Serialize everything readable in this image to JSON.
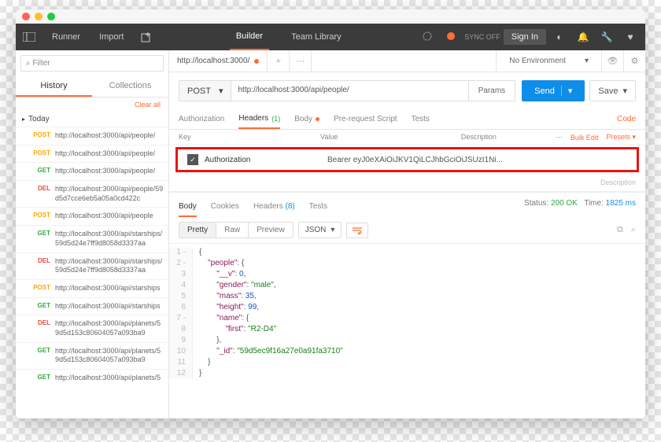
{
  "topbar": {
    "runner": "Runner",
    "import": "Import",
    "tabs": {
      "builder": "Builder",
      "teamlib": "Team Library"
    },
    "sync": "SYNC OFF",
    "signin": "Sign In"
  },
  "sidebar": {
    "filter_placeholder": "Filter",
    "tabs": {
      "history": "History",
      "collections": "Collections"
    },
    "clear": "Clear all",
    "group": "Today",
    "items": [
      {
        "m": "POST",
        "u": "http://localhost:3000/api/people/"
      },
      {
        "m": "POST",
        "u": "http://localhost:3000/api/people/"
      },
      {
        "m": "GET",
        "u": "http://localhost:3000/api/people/"
      },
      {
        "m": "DEL",
        "u": "http://localhost:3000/api/people/59d5d7cce6eb5a05a0cd422c"
      },
      {
        "m": "POST",
        "u": "http://localhost:3000/api/people"
      },
      {
        "m": "GET",
        "u": "http://localhost:3000/api/starships/59d5d24e7ff9d8058d3337aa"
      },
      {
        "m": "DEL",
        "u": "http://localhost:3000/api/starships/59d5d24e7ff9d8058d3337aa"
      },
      {
        "m": "POST",
        "u": "http://localhost:3000/api/starships"
      },
      {
        "m": "GET",
        "u": "http://localhost:3000/api/starships"
      },
      {
        "m": "DEL",
        "u": "http://localhost:3000/api/planets/59d5d153c80604057a093ba9"
      },
      {
        "m": "GET",
        "u": "http://localhost:3000/api/planets/59d5d153c80604057a093ba9"
      },
      {
        "m": "GET",
        "u": "http://localhost:3000/api/planets/5"
      }
    ]
  },
  "request": {
    "tab_title": "http://localhost:3000/",
    "method": "POST",
    "url": "http://localhost:3000/api/people/",
    "params": "Params",
    "send": "Send",
    "save": "Save",
    "env": "No Environment",
    "tabs": {
      "auth": "Authorization",
      "headers": "Headers",
      "headers_c": "(1)",
      "body": "Body",
      "prereq": "Pre-request Script",
      "tests": "Tests",
      "code": "Code"
    },
    "hdr_cols": {
      "key": "Key",
      "value": "Value",
      "desc": "Description",
      "bulk": "Bulk Edit",
      "presets": "Presets"
    },
    "hdr_row": {
      "key": "Authorization",
      "value": "Bearer eyJ0eXAiOiJKV1QiLCJhbGciOiJSUzI1Ni..."
    },
    "hdr_row2": {
      "desc": "Description"
    }
  },
  "response": {
    "tabs": {
      "body": "Body",
      "cookies": "Cookies",
      "headers": "Headers",
      "headers_c": "(8)",
      "tests": "Tests"
    },
    "status_lbl": "Status:",
    "status": "200 OK",
    "time_lbl": "Time:",
    "time": "1825 ms",
    "views": {
      "pretty": "Pretty",
      "raw": "Raw",
      "preview": "Preview"
    },
    "fmt": "JSON",
    "lines": [
      {
        "n": 1,
        "c": "{",
        "indent": 0,
        "t": "pun",
        "fold": "-"
      },
      {
        "n": 2,
        "c": "\"people\": {",
        "indent": 1,
        "fold": "-",
        "kv": [
          [
            "key",
            "\"people\""
          ],
          [
            "pun",
            ": {"
          ]
        ]
      },
      {
        "n": 3,
        "indent": 2,
        "kv": [
          [
            "key",
            "\"__v\""
          ],
          [
            "pun",
            ": "
          ],
          [
            "num",
            "0"
          ],
          [
            "pun",
            ","
          ]
        ]
      },
      {
        "n": 4,
        "indent": 2,
        "kv": [
          [
            "key",
            "\"gender\""
          ],
          [
            "pun",
            ": "
          ],
          [
            "str",
            "\"male\""
          ],
          [
            "pun",
            ","
          ]
        ]
      },
      {
        "n": 5,
        "indent": 2,
        "kv": [
          [
            "key",
            "\"mass\""
          ],
          [
            "pun",
            ": "
          ],
          [
            "num",
            "35"
          ],
          [
            "pun",
            ","
          ]
        ]
      },
      {
        "n": 6,
        "indent": 2,
        "kv": [
          [
            "key",
            "\"height\""
          ],
          [
            "pun",
            ": "
          ],
          [
            "num",
            "99"
          ],
          [
            "pun",
            ","
          ]
        ]
      },
      {
        "n": 7,
        "indent": 2,
        "fold": "-",
        "kv": [
          [
            "key",
            "\"name\""
          ],
          [
            "pun",
            ": {"
          ]
        ]
      },
      {
        "n": 8,
        "indent": 3,
        "kv": [
          [
            "key",
            "\"first\""
          ],
          [
            "pun",
            ": "
          ],
          [
            "str",
            "\"R2-D4\""
          ]
        ]
      },
      {
        "n": 9,
        "indent": 2,
        "kv": [
          [
            "pun",
            "},"
          ]
        ]
      },
      {
        "n": 10,
        "indent": 2,
        "kv": [
          [
            "key",
            "\"_id\""
          ],
          [
            "pun",
            ": "
          ],
          [
            "str",
            "\"59d5ec9f16a27e0a91fa3710\""
          ]
        ]
      },
      {
        "n": 11,
        "indent": 1,
        "kv": [
          [
            "pun",
            "}"
          ]
        ]
      },
      {
        "n": 12,
        "indent": 0,
        "kv": [
          [
            "pun",
            "}"
          ]
        ]
      }
    ]
  }
}
